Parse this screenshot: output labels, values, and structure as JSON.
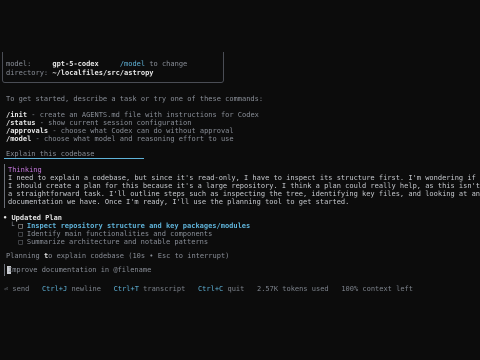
{
  "header": {
    "model_label": "model:",
    "model_value": "gpt-5-codex",
    "model_hint_cmd": "/model",
    "model_hint_text": "to change",
    "dir_label": "directory:",
    "dir_value": "~/localfiles/src/astropy"
  },
  "intro": "To get started, describe a task or try one of these commands:",
  "commands": [
    {
      "cmd": "/init",
      "desc": " - create an AGENTS.md file with instructions for Codex"
    },
    {
      "cmd": "/status",
      "desc": " - show current session configuration"
    },
    {
      "cmd": "/approvals",
      "desc": " - choose what Codex can do without approval"
    },
    {
      "cmd": "/model",
      "desc": " - choose what model and reasoning effort to use"
    }
  ],
  "user_prompt": "Explain this codebase",
  "thinking": {
    "label": "Thinking",
    "lines": [
      "I need to explain a codebase, but since it's read-only, I have to inspect its structure first. I'm wondering if",
      "I should create a plan for this because it's a large repository. I think a plan could really help, as this isn't",
      "a straightforward task. I'll outline steps such as inspecting the tree, identifying key files, and looking at any",
      "documentation we have. Once I'm ready, I'll use the planning tool to get started."
    ]
  },
  "plan": {
    "title": "Updated Plan",
    "items": [
      {
        "box": "□",
        "text": "Inspect repository structure and key packages/modules",
        "active": true
      },
      {
        "box": "□",
        "text": "Identify main functionalities and components",
        "active": false
      },
      {
        "box": "□",
        "text": "Summarize architecture and notable patterns",
        "active": false
      }
    ]
  },
  "status_line": {
    "pre": "Planning ",
    "hl": "t",
    "post": "o explain codebase (10s • Esc to interrupt)"
  },
  "composer_placeholder": "Improve documentation in @filename",
  "footer": {
    "send": "⏎ send",
    "newline_key": "Ctrl+J",
    "newline": "newline",
    "transcript_key": "Ctrl+T",
    "transcript": "transcript",
    "quit_key": "Ctrl+C",
    "quit": "quit",
    "tokens": "2.57K tokens used",
    "context": "100% context left"
  },
  "colors": {
    "background": "#0c0c0c",
    "accent": "#5fb3d9",
    "thinking": "#c678dd"
  }
}
